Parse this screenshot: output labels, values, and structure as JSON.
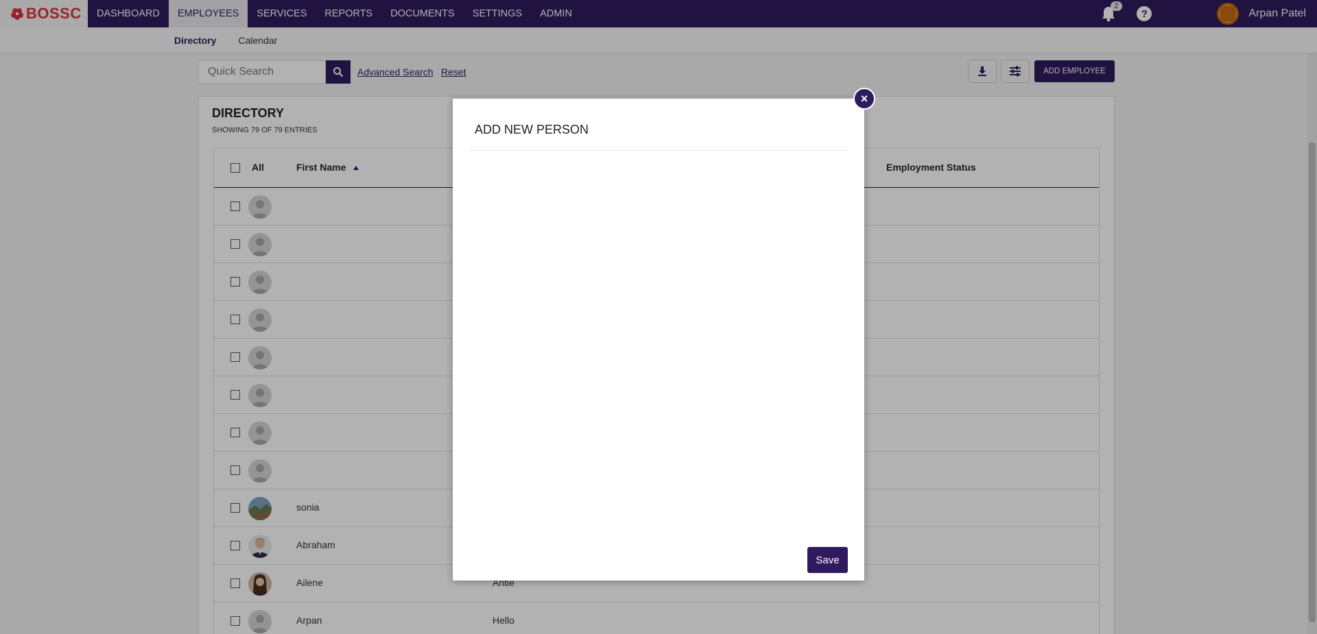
{
  "brand": {
    "name": "BOSSC",
    "color": "#d9343f"
  },
  "colors": {
    "primary": "#2e1a5e"
  },
  "nav": {
    "items": [
      {
        "label": "DASHBOARD"
      },
      {
        "label": "EMPLOYEES",
        "active": true
      },
      {
        "label": "SERVICES"
      },
      {
        "label": "REPORTS"
      },
      {
        "label": "DOCUMENTS"
      },
      {
        "label": "SETTINGS"
      },
      {
        "label": "ADMIN"
      }
    ],
    "notifications_count": "2",
    "help_label": "?",
    "user_name": "Arpan Patel"
  },
  "subnav": {
    "items": [
      {
        "label": "Directory",
        "active": true
      },
      {
        "label": "Calendar"
      }
    ]
  },
  "toolbar": {
    "search_placeholder": "Quick Search",
    "advanced_search": "Advanced Search",
    "reset": "Reset",
    "add_employee": "ADD EMPLOYEE"
  },
  "directory": {
    "title": "DIRECTORY",
    "subtitle": "SHOWING 79 OF 79 ENTRIES",
    "columns": {
      "all": "All",
      "first_name": "First Name",
      "employment_status": "Employment Status"
    },
    "rows": [
      {
        "first_name": "",
        "last_name": ""
      },
      {
        "first_name": "",
        "last_name": ""
      },
      {
        "first_name": "",
        "last_name": ""
      },
      {
        "first_name": "",
        "last_name": ""
      },
      {
        "first_name": "",
        "last_name": ""
      },
      {
        "first_name": "",
        "last_name": ""
      },
      {
        "first_name": "",
        "last_name": ""
      },
      {
        "first_name": "",
        "last_name": ""
      },
      {
        "first_name": "sonia",
        "last_name": "",
        "avatar": "landscape-photo"
      },
      {
        "first_name": "Abraham",
        "last_name": "",
        "avatar": "man-photo"
      },
      {
        "first_name": "Ailene",
        "last_name": "Antie",
        "avatar": "woman-photo"
      },
      {
        "first_name": "Arpan",
        "last_name": "Hello"
      }
    ]
  },
  "modal": {
    "title": "ADD NEW PERSON",
    "close_label": "×",
    "save_label": "Save"
  }
}
